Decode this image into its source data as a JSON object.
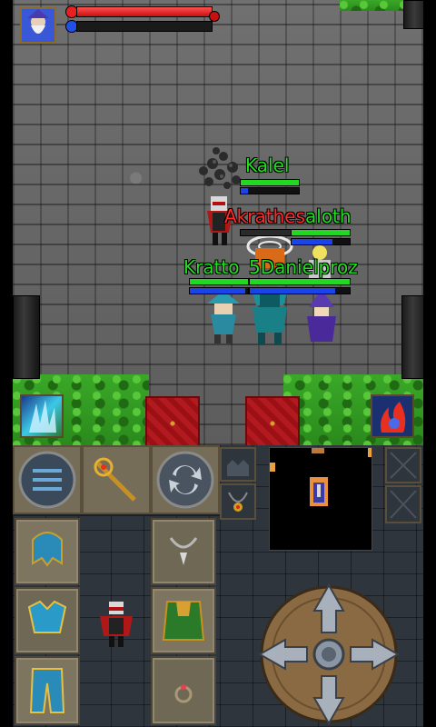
{
  "players": [
    {
      "name": "Kalel",
      "color": "#22dd22",
      "hp": 1.0,
      "mp": 0.12
    },
    {
      "name": "Akrathes",
      "color": "#ff2a2a",
      "hp": 0.0,
      "mp": 0.0
    },
    {
      "name": "aloth",
      "color": "#22dd22",
      "hp": 1.0,
      "mp": 0.7
    },
    {
      "name": "Kratto",
      "color": "#22dd22",
      "hp": 1.0,
      "mp": 0.95
    },
    {
      "name": "5Danielproz",
      "color": "#22dd22",
      "hp": 1.0,
      "mp": 0.85
    }
  ],
  "hud": {
    "player_hp": 1.0,
    "player_mp": 0.0,
    "portrait_icon": "wizard-portrait-icon"
  },
  "skills": {
    "left": "ice-shard-skill-icon",
    "right": "fire-potion-skill-icon"
  },
  "menu": {
    "menu_icon": "hamburger-menu-icon",
    "weapon_icon": "golden-staff-icon",
    "swap_icon": "swap-arrows-icon"
  },
  "equipment": {
    "helmet": "blue-helmet-icon",
    "amulet": "silver-amulet-icon",
    "armor": "blue-armor-icon",
    "cape": "green-cape-icon",
    "legs": "blue-legs-icon",
    "ring": "ring-icon",
    "avatar": "character-avatar-icon"
  },
  "side_panel": {
    "up_icon": "scroll-up-icon",
    "necklace_icon": "necklace-icon",
    "close1": "close-x-icon",
    "close2": "close-x-icon"
  },
  "dpad": {
    "icon": "dpad-arrows-icon"
  },
  "colors": {
    "hp": "#22d822",
    "mp": "#1844e8",
    "enemy_name": "#ff2a2a",
    "ally_name": "#22dd22"
  }
}
